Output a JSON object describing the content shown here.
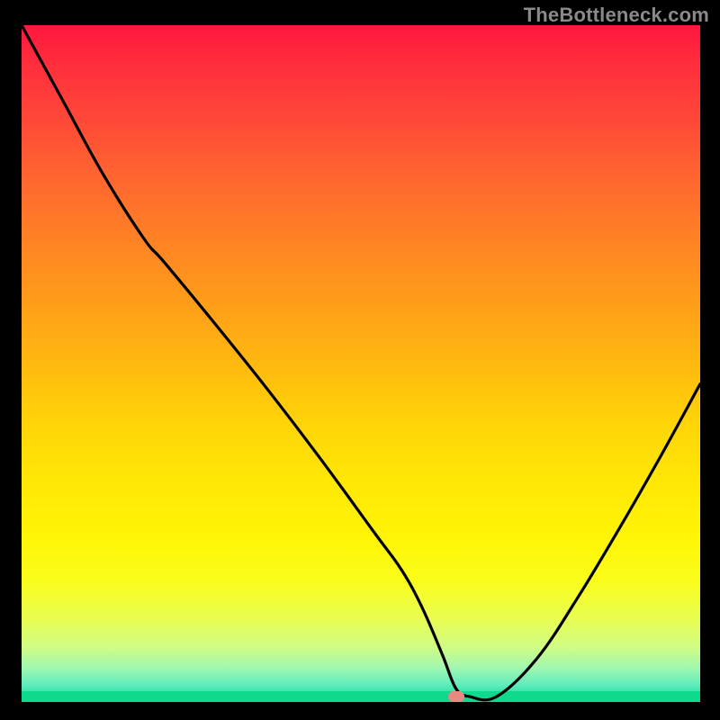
{
  "watermark": "TheBottleneck.com",
  "colors": {
    "frame": "#000000",
    "marker": "#e68a82",
    "curve": "#000000"
  },
  "chart_data": {
    "type": "line",
    "title": "",
    "xlabel": "",
    "ylabel": "",
    "xlim": [
      0,
      100
    ],
    "ylim": [
      0,
      100
    ],
    "grid": false,
    "legend": false,
    "series": [
      {
        "name": "bottleneck-curve",
        "x": [
          0,
          6,
          12,
          18,
          21,
          28,
          36,
          44,
          52,
          56,
          59,
          62,
          64,
          66,
          70,
          76,
          82,
          88,
          94,
          100
        ],
        "y": [
          100,
          89,
          78,
          68.5,
          65,
          56.5,
          46.5,
          36,
          25,
          19.5,
          14,
          7,
          2,
          0.8,
          0.8,
          6.5,
          15.5,
          25.5,
          36,
          47
        ]
      }
    ],
    "annotations": [
      {
        "name": "optimal-marker",
        "x": 64,
        "y": 0.8
      }
    ]
  }
}
